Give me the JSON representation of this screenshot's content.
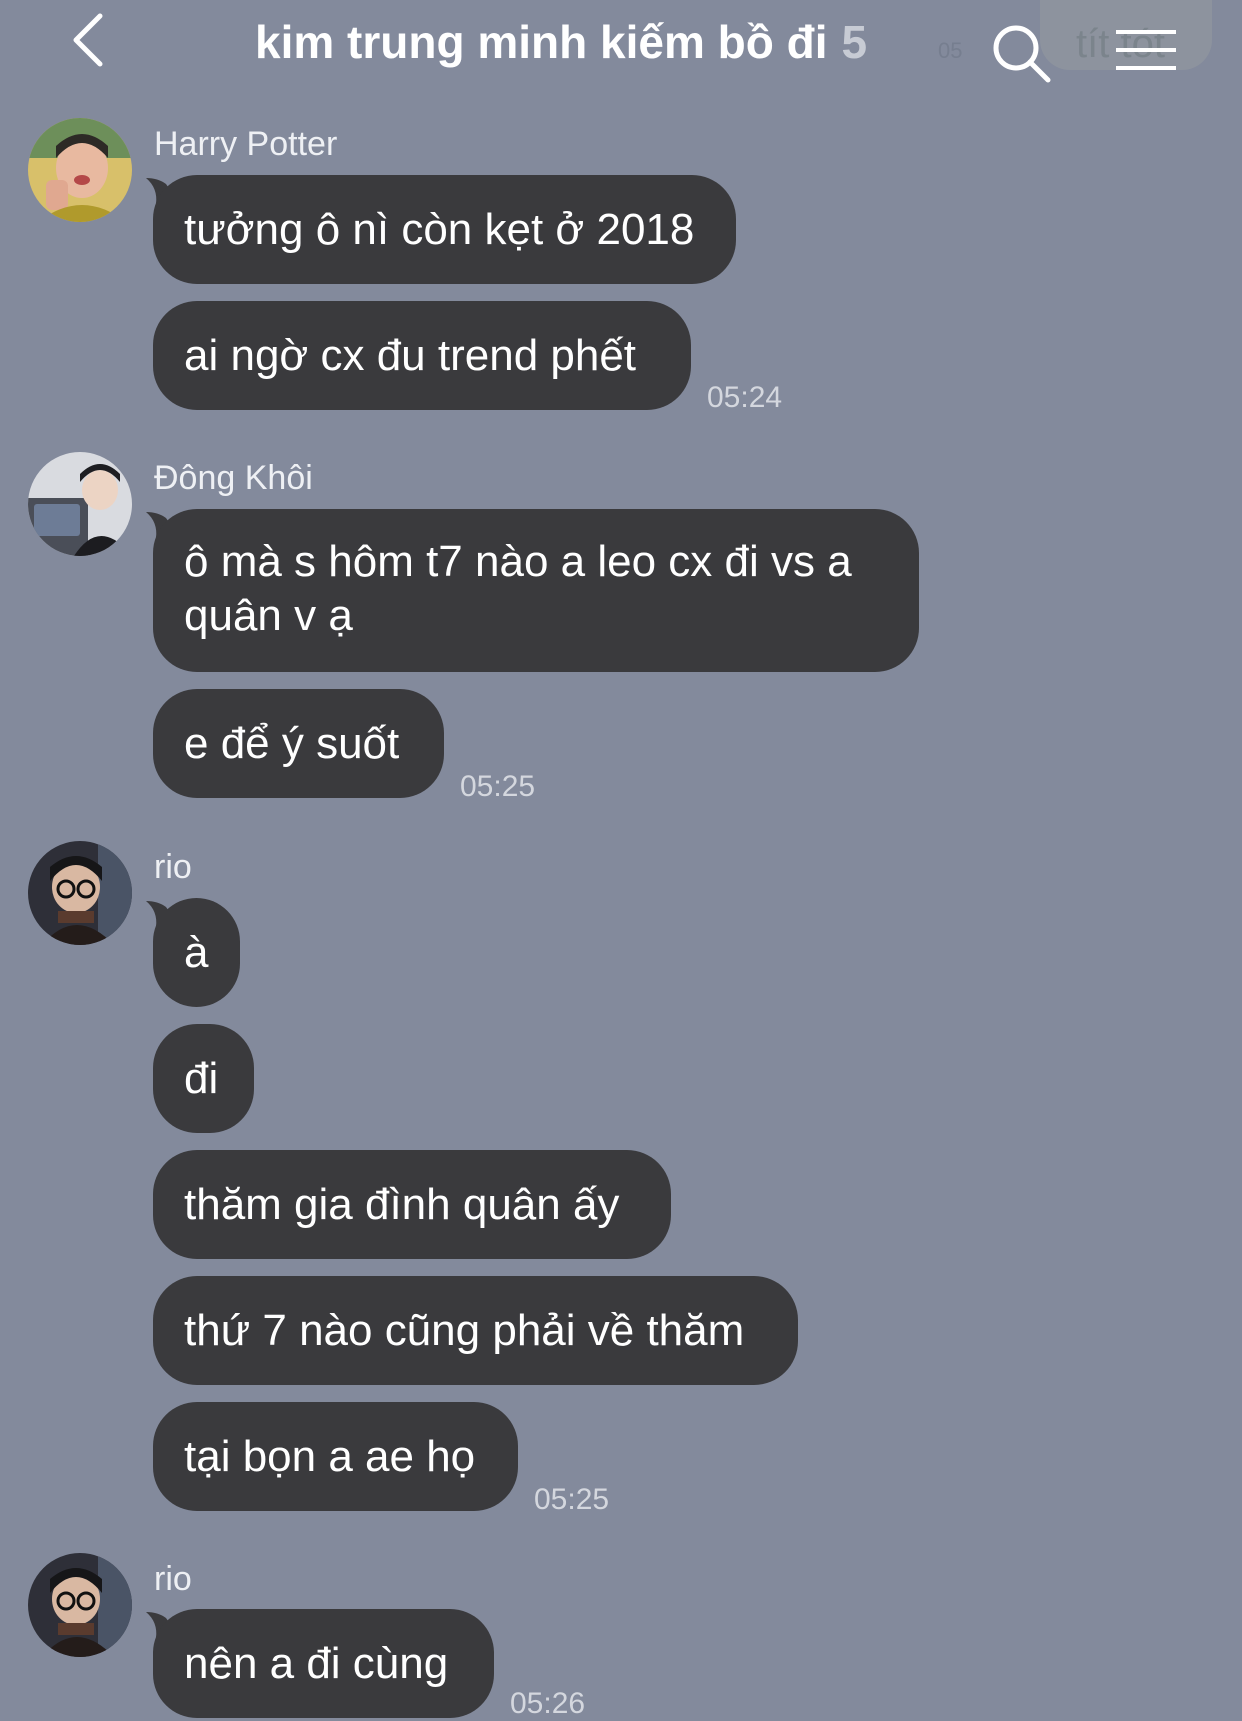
{
  "header": {
    "title": "kim trung minh kiếm bồ đi",
    "member_count": "5",
    "back_icon": "chevron-left-icon",
    "search_icon": "search-icon",
    "menu_icon": "hamburger-menu-icon",
    "ghost_bubble_text": "tít tót",
    "ghost_time": "05"
  },
  "messages": [
    {
      "sender": "Harry Potter",
      "bubbles": [
        "tưởng ô nì còn kẹt ở 2018",
        "ai ngờ cx đu trend phết"
      ],
      "time": "05:24"
    },
    {
      "sender": "Đông Khôi",
      "bubbles": [
        "ô mà s hôm t7 nào a leo cx đi vs a quân v ạ",
        "e để ý suốt"
      ],
      "time": "05:25"
    },
    {
      "sender": "rio",
      "bubbles": [
        "à",
        "đi",
        "thăm gia đình quân ấy",
        "thứ 7 nào cũng phải về thăm",
        "tại bọn a ae họ"
      ],
      "time": "05:25"
    },
    {
      "sender": "rio",
      "bubbles": [
        "nên a đi cùng"
      ],
      "time": "05:26"
    }
  ],
  "colors": {
    "background": "#838a9c",
    "bubble": "#3a3a3d",
    "bubble_text": "#ffffff",
    "sender_text": "#eef0f4",
    "time_text": "#d4d7de"
  }
}
